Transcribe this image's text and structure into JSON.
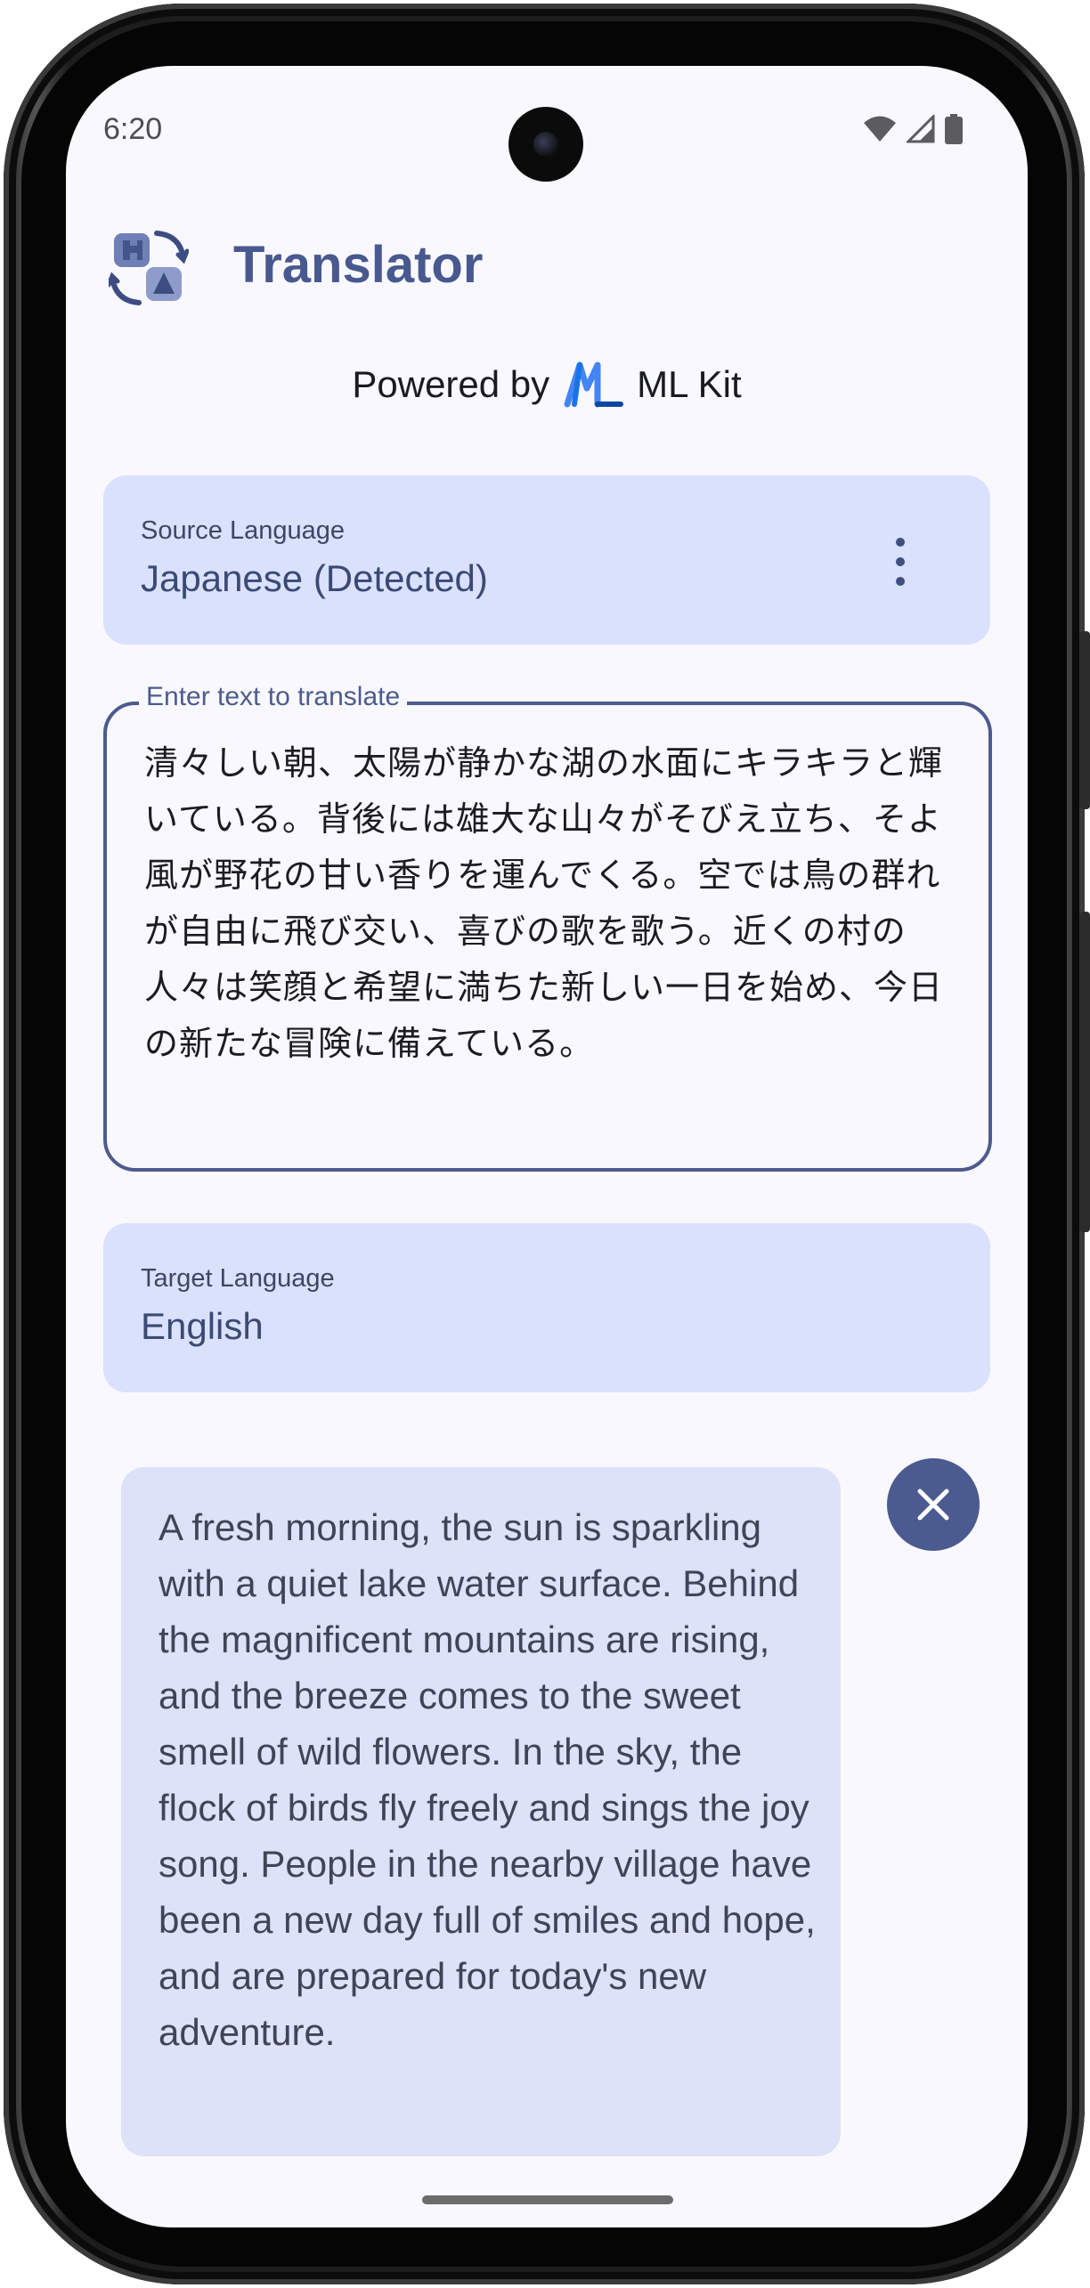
{
  "status_bar": {
    "time": "6:20",
    "icons": [
      "wifi-icon",
      "cellular-signal-icon",
      "battery-icon"
    ]
  },
  "app": {
    "title": "Translator",
    "logo": "translator-logo-icon",
    "powered_by": "Powered by",
    "powered_brand": "ML Kit"
  },
  "source_language": {
    "label": "Source Language",
    "value": "Japanese (Detected)",
    "menu_icon": "more-vert-icon"
  },
  "input": {
    "label": "Enter text to translate",
    "value": "清々しい朝、太陽が静かな湖の水面にキラキラと輝いている。背後には雄大な山々がそびえ立ち、そよ風が野花の甘い香りを運んでくる。空では鳥の群れが自由に飛び交い、喜びの歌を歌う。近くの村の人々は笑顔と希望に満ちた新しい一日を始め、今日の新たな冒険に備えている。"
  },
  "target_language": {
    "label": "Target Language",
    "value": "English"
  },
  "output": {
    "text": "A fresh morning, the sun is sparkling with a quiet lake water surface. Behind the magnificent mountains are rising, and the breeze comes to the sweet smell of wild flowers. In the sky, the flock of birds fly freely and sings the joy song. People in the nearby village have been a new day full of smiles and hope, and are prepared for today's new adventure.",
    "clear_icon": "close-icon"
  },
  "colors": {
    "accent": "#4b5b8f",
    "card": "#d9e1fd",
    "output_card": "#dde2f8",
    "background": "#f8f8fe"
  }
}
